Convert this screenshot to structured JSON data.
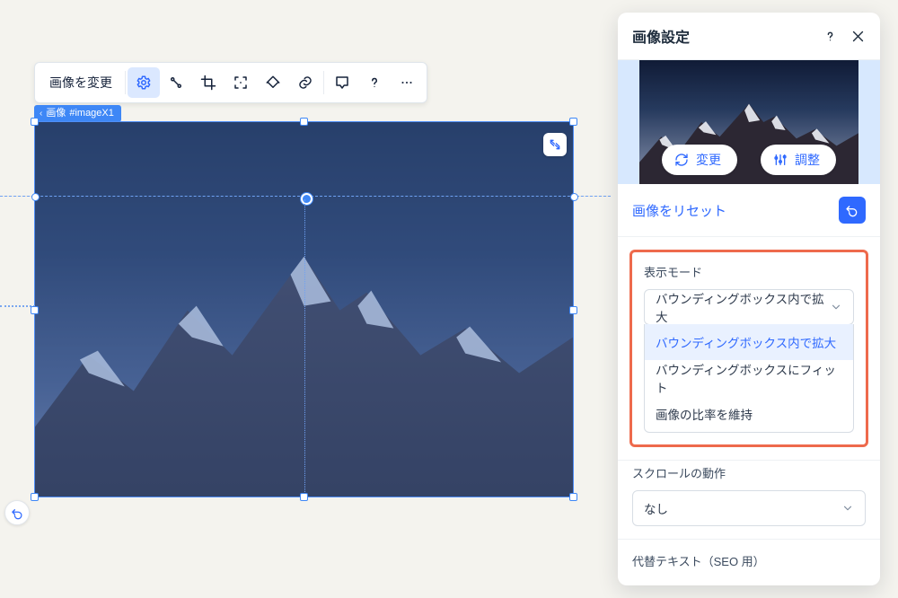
{
  "toolbar": {
    "change_label": "画像を変更",
    "icons": [
      "settings",
      "animation",
      "crop",
      "focal",
      "mask",
      "link",
      "comment",
      "help",
      "more"
    ]
  },
  "element_tag": {
    "prefix": "画像",
    "id": "#imageX1"
  },
  "panel": {
    "title": "画像設定",
    "change_btn": "変更",
    "adjust_btn": "調整",
    "reset_link": "画像をリセット",
    "display_mode": {
      "label": "表示モード",
      "value": "バウンディングボックス内で拡大",
      "options": [
        "バウンディングボックス内で拡大",
        "バウンディングボックスにフィット",
        "画像の比率を維持"
      ]
    },
    "scroll_behavior": {
      "label": "スクロールの動作",
      "value": "なし"
    },
    "alt_text": {
      "label": "代替テキスト（SEO 用）"
    }
  }
}
